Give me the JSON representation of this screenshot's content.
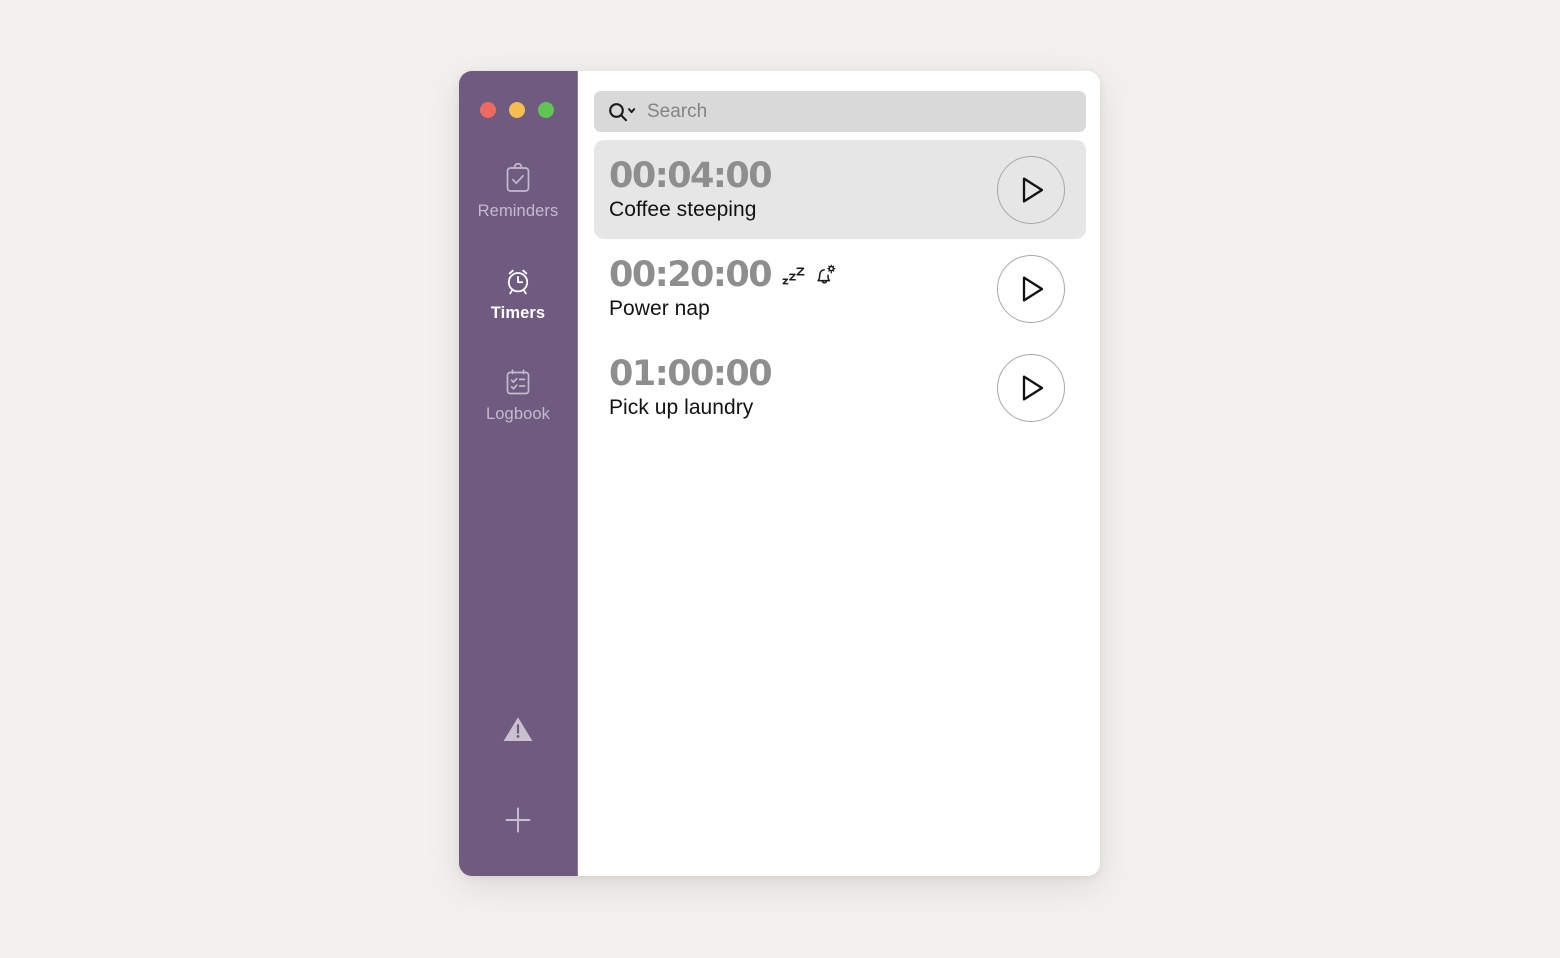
{
  "window": {
    "title": "Timers",
    "traffic_lights": [
      {
        "name": "close",
        "color": "#ee6a5f"
      },
      {
        "name": "minimize",
        "color": "#f5bd4f"
      },
      {
        "name": "maximize",
        "color": "#61c554"
      }
    ]
  },
  "sidebar": {
    "background_color": "#6f5a80",
    "items": [
      {
        "label": "Reminders",
        "icon": "clipboard-check-icon",
        "selected": false
      },
      {
        "label": "Timers",
        "icon": "alarm-clock-icon",
        "selected": true
      },
      {
        "label": "Logbook",
        "icon": "checklist-icon",
        "selected": false
      }
    ],
    "bottom_actions": [
      {
        "name": "warning-button",
        "icon": "warning-triangle-icon"
      },
      {
        "name": "add-button",
        "icon": "plus-icon"
      }
    ]
  },
  "search": {
    "placeholder": "Search",
    "value": "",
    "icon": "search-icon",
    "dropdown_icon": "chevron-down-icon"
  },
  "timers": [
    {
      "time": "00:04:00",
      "name": "Coffee steeping",
      "selected": true,
      "badges": [],
      "action": "play"
    },
    {
      "time": "00:20:00",
      "name": "Power nap",
      "selected": false,
      "badges": [
        "sleep-zzz-icon",
        "bell-gear-icon"
      ],
      "action": "play"
    },
    {
      "time": "01:00:00",
      "name": "Pick up laundry",
      "selected": false,
      "badges": [],
      "action": "play"
    }
  ]
}
